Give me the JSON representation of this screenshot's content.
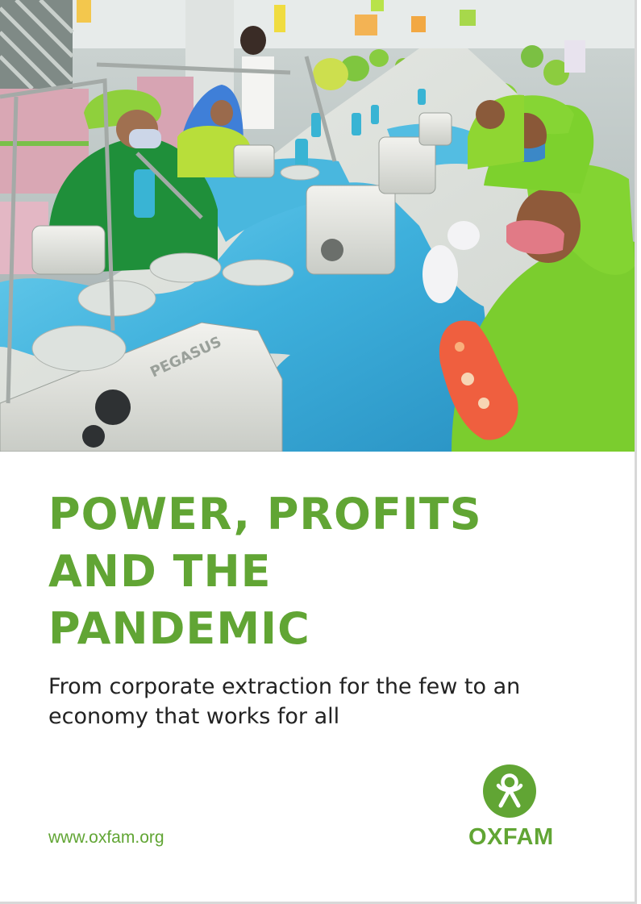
{
  "cover": {
    "title_lines": [
      "POWER, PROFITS",
      "AND THE",
      "PANDEMIC"
    ],
    "subtitle_lines": [
      "From corporate extraction for the few to an",
      "economy that works for all"
    ],
    "website": "www.oxfam.org",
    "logo_text": "OXFAM",
    "logo_icon": "oxfam-figure-icon"
  },
  "photo": {
    "subject": "garment factory workers at sewing machines",
    "machine_label": "PEGASUS"
  },
  "colors": {
    "brand_green": "#61a534",
    "text_dark": "#222222",
    "fabric_blue": "#4cb6dc"
  }
}
